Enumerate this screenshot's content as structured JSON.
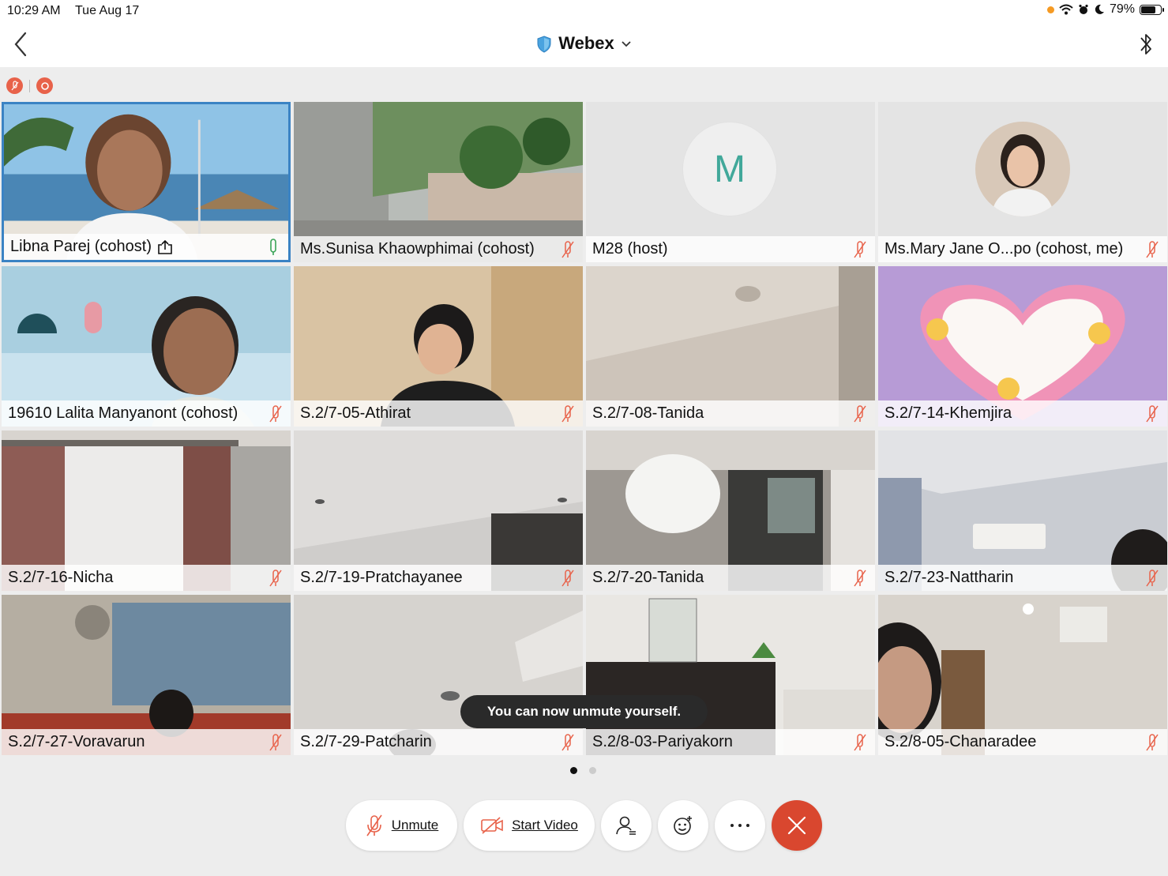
{
  "status_bar": {
    "time": "10:29 AM",
    "date": "Tue Aug 17",
    "battery": "79%",
    "battery_level": 0.79
  },
  "nav": {
    "title": "Webex"
  },
  "tiles": [
    {
      "name": "Libna Parej (cohost)",
      "mic": "on",
      "sharing": true,
      "active": true
    },
    {
      "name": "Ms.Sunisa Khaowphimai (cohost)",
      "mic": "muted"
    },
    {
      "name": "M28 (host)",
      "mic": "muted",
      "avatar_letter": "M"
    },
    {
      "name": "Ms.Mary Jane O...po (cohost, me)",
      "mic": "muted"
    },
    {
      "name": "19610 Lalita Manyanont (cohost)",
      "mic": "muted"
    },
    {
      "name": "S.2/7-05-Athirat",
      "mic": "muted"
    },
    {
      "name": "S.2/7-08-Tanida",
      "mic": "muted"
    },
    {
      "name": "S.2/7-14-Khemjira",
      "mic": "muted"
    },
    {
      "name": "S.2/7-16-Nicha",
      "mic": "muted"
    },
    {
      "name": "S.2/7-19-Pratchayanee",
      "mic": "muted"
    },
    {
      "name": "S.2/7-20-Tanida",
      "mic": "muted"
    },
    {
      "name": "S.2/7-23-Nattharin",
      "mic": "muted"
    },
    {
      "name": "S.2/7-27-Voravarun",
      "mic": "muted"
    },
    {
      "name": "S.2/7-29-Patcharin",
      "mic": "muted"
    },
    {
      "name": "S.2/8-03-Pariyakorn",
      "mic": "muted"
    },
    {
      "name": "S.2/8-05-Chanaradee",
      "mic": "muted"
    }
  ],
  "toast": "You can now unmute yourself.",
  "pager": {
    "pages": 2,
    "current": 1
  },
  "controls": {
    "unmute": "Unmute",
    "start_video": "Start Video"
  },
  "colors": {
    "accent": "#3b83c4",
    "muted_red": "#e8624a",
    "end_call": "#d9472f",
    "mic_on_green": "#3aa457",
    "avatar_teal": "#41a89a"
  },
  "icons": [
    "back-chevron-icon",
    "shield-icon",
    "chevron-down-icon",
    "bluetooth-icon",
    "mic-muted-icon",
    "mic-icon",
    "share-icon",
    "video-off-icon",
    "participants-icon",
    "reactions-icon",
    "more-icon",
    "close-icon"
  ]
}
